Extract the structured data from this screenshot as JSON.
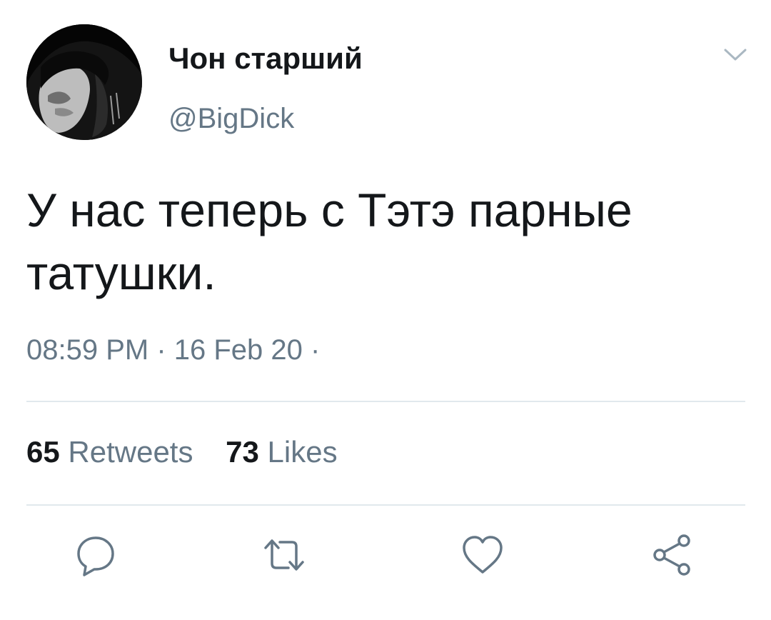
{
  "tweet": {
    "author": {
      "display_name": "Чон старший",
      "handle": "@BigDick"
    },
    "text": "У нас теперь с Тэтэ парные татушки.",
    "timestamp": "08:59 PM · 16 Feb 20 ·",
    "stats": {
      "retweets": {
        "count": "65",
        "label": "Retweets"
      },
      "likes": {
        "count": "73",
        "label": "Likes"
      }
    },
    "actions": [
      {
        "icon": "reply-icon"
      },
      {
        "icon": "retweet-icon"
      },
      {
        "icon": "like-icon"
      },
      {
        "icon": "share-icon"
      }
    ]
  },
  "colors": {
    "primary_text": "#14171a",
    "secondary_text": "#657786",
    "divider": "#e1e8ed",
    "icon": "#657786"
  }
}
